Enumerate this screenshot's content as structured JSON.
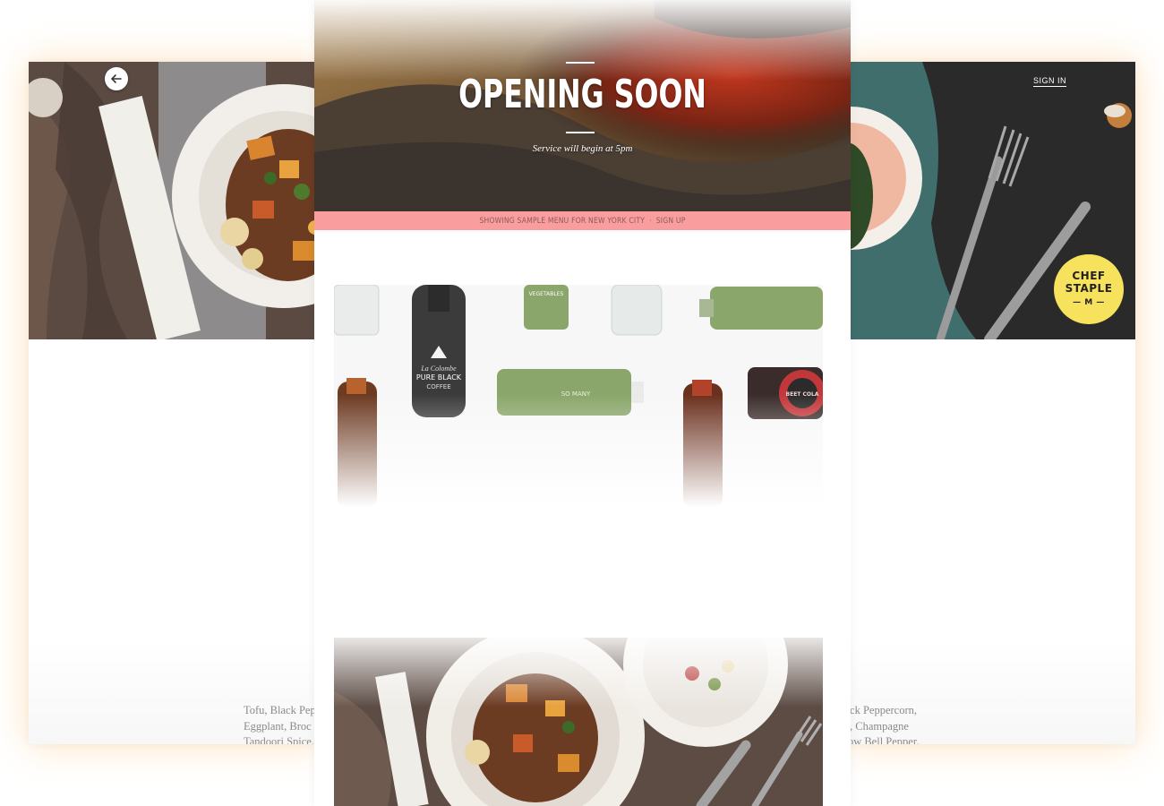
{
  "left_card": {
    "back_icon": "arrow-left-icon",
    "description_lines": [
      "Tofu, Black Pep",
      "Eggplant, Broc",
      "Tandoori Spice, ."
    ]
  },
  "right_card": {
    "sign_in_label": "SIGN IN",
    "badge": {
      "line1": "CHEF",
      "line2": "STAPLE",
      "line3": "— M —"
    },
    "description_lines": [
      "lack Peppercorn,",
      "ic, Champagne",
      "llow Bell Pepper,"
    ]
  },
  "center": {
    "hero_title": "OPENING SOON",
    "hero_subtitle": "Service will begin at 5pm",
    "banner_text": "SHOWING SAMPLE MENU FOR NEW YORK CITY",
    "banner_separator": "·",
    "banner_link": "SIGN UP",
    "bottle_labels": {
      "coffee_line1": "La Colombe",
      "coffee_line2": "PURE BLACK",
      "coffee_line3": "COFFEE",
      "veg_label": "VEGETABLES",
      "so_many": "SO MANY",
      "beet": "BEET COLA"
    }
  },
  "colors": {
    "banner": "#f99d9f",
    "badge": "#f7e25d",
    "bottle_green": "#8aa66a"
  }
}
